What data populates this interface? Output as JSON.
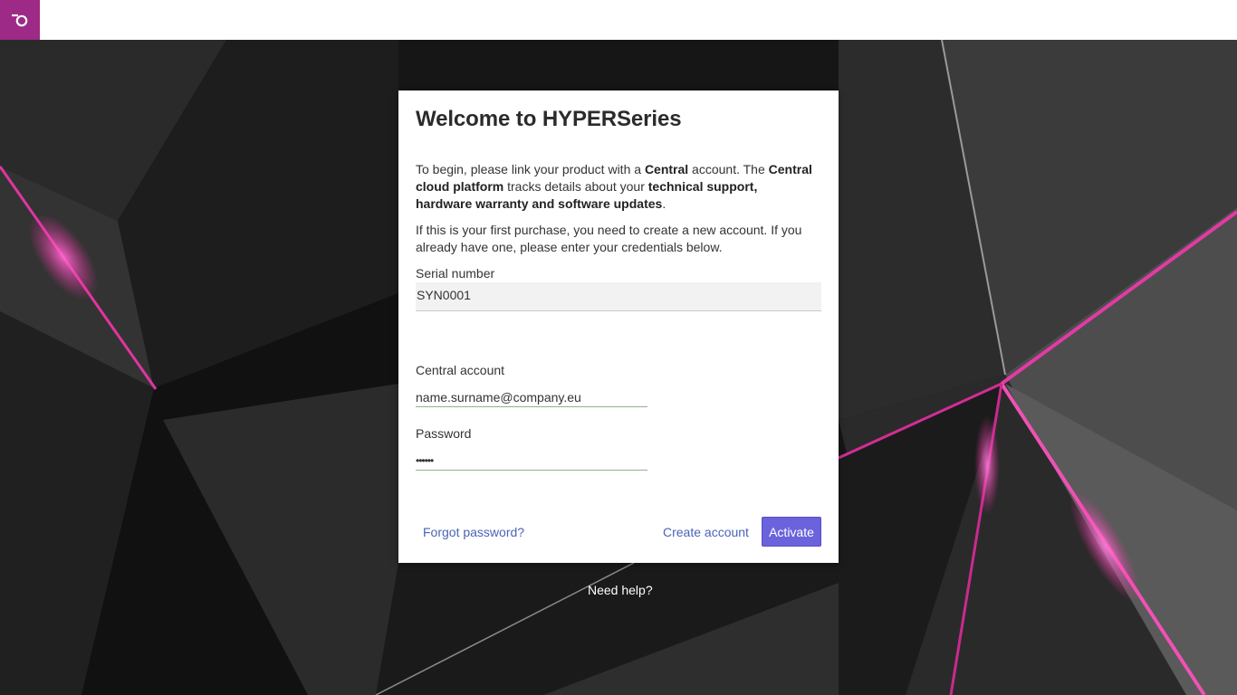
{
  "topbar": {
    "logo_icon": "brand-logo-icon",
    "logo_color": "#9c2a86"
  },
  "dialog": {
    "title": "Welcome to HYPERSeries",
    "intro": {
      "p1_a": "To begin, please link your product with a ",
      "p1_b": "Central",
      "p1_c": " account. The ",
      "p1_d": "Central cloud platform",
      "p1_e": " tracks details about your ",
      "p1_f": "technical support, hardware warranty and software updates",
      "p1_g": ".",
      "p2": "If this is your first purchase, you need to create a new account. If you already have one, please enter your credentials below."
    },
    "serial": {
      "label": "Serial number",
      "value": "SYN0001"
    },
    "account": {
      "label": "Central account",
      "value": "name.surname@company.eu"
    },
    "password": {
      "label": "Password",
      "value": "••••••"
    },
    "actions": {
      "forgot": "Forgot password?",
      "create": "Create account",
      "activate": "Activate"
    },
    "accent_color": "#6b63dc",
    "link_color": "#4a63b8"
  },
  "footer": {
    "help": "Need help?"
  }
}
